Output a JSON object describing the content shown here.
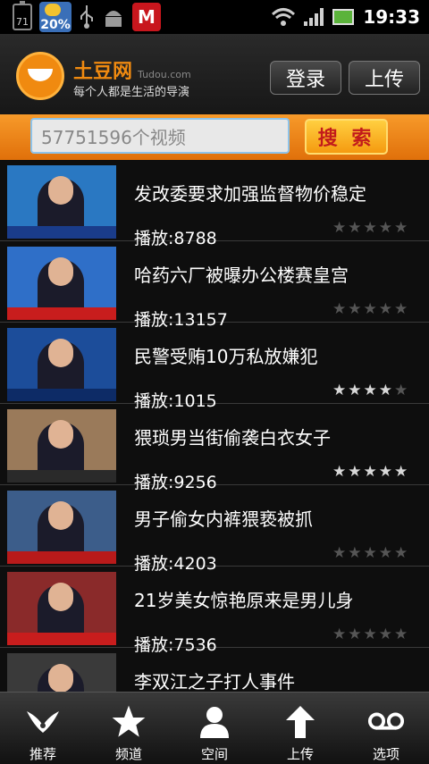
{
  "status_bar": {
    "battery_level": "71",
    "weather_percent": "20%",
    "time": "19:33",
    "icons": [
      "battery-icon",
      "weather-icon",
      "usb-icon",
      "android-debug-icon",
      "mcafee-icon",
      "wifi-icon",
      "signal-icon",
      "charging-battery-icon"
    ]
  },
  "header": {
    "brand_name": "土豆网",
    "brand_domain": "Tudou.com",
    "slogan": "每个人都是生活的导演",
    "login_label": "登录",
    "upload_label": "上传"
  },
  "search": {
    "value": "57751596个视频",
    "button_label": "搜 索"
  },
  "videos": [
    {
      "title": "发改委要求加强监督物价稳定",
      "plays": "播放:8788",
      "rating": 0
    },
    {
      "title": "哈药六厂被曝办公楼赛皇宫",
      "plays": "播放:13157",
      "rating": 0
    },
    {
      "title": "民警受贿10万私放嫌犯",
      "plays": "播放:1015",
      "rating": 4
    },
    {
      "title": "猥琐男当街偷袭白衣女子",
      "plays": "播放:9256",
      "rating": 5
    },
    {
      "title": "男子偷女内裤猥亵被抓",
      "plays": "播放:4203",
      "rating": 0
    },
    {
      "title": "21岁美女惊艳原来是男儿身",
      "plays": "播放:7536",
      "rating": 0
    },
    {
      "title": "李双江之子打人事件",
      "plays": "",
      "rating": 0
    }
  ],
  "thumbnails": [
    {
      "icon": "news-anchor-thumbnail",
      "bg": "#2a78c2",
      "cap": "#1a3c8a"
    },
    {
      "icon": "news-screen-thumbnail",
      "bg": "#2f6fc8",
      "cap": "#c81d1d"
    },
    {
      "icon": "news-anchor-thumbnail",
      "bg": "#1c4d9a",
      "cap": "#0d2b66"
    },
    {
      "icon": "street-scene-thumbnail",
      "bg": "#9a7a5a",
      "cap": "#2a2a2a"
    },
    {
      "icon": "news-anchor-thumbnail",
      "bg": "#3c5d8a",
      "cap": "#b81a1a"
    },
    {
      "icon": "news-anchor-thumbnail",
      "bg": "#8a2a2a",
      "cap": "#c81d1d"
    },
    {
      "icon": "news-thumbnail",
      "bg": "#3a3a3a",
      "cap": "#2a2a2a"
    }
  ],
  "nav": [
    {
      "label": "推荐",
      "icon": "recommend-icon"
    },
    {
      "label": "频道",
      "icon": "channel-star-icon"
    },
    {
      "label": "空间",
      "icon": "user-space-icon"
    },
    {
      "label": "上传",
      "icon": "upload-arrow-icon"
    },
    {
      "label": "选项",
      "icon": "options-icon"
    }
  ],
  "colors": {
    "accent": "#f08a10",
    "search_band": "#f07f15",
    "star_filled": "#d8d8d8",
    "star_empty": "#555555"
  }
}
